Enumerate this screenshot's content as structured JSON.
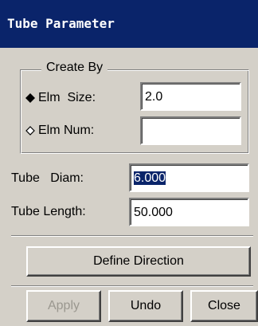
{
  "window": {
    "title": "Tube Parameter"
  },
  "create_by": {
    "legend": "Create By",
    "options": [
      {
        "label": "Elm  Size:",
        "selected": true,
        "value": "2.0"
      },
      {
        "label": "Elm Num:",
        "selected": false,
        "value": ""
      }
    ]
  },
  "tube": {
    "diam_label": "Tube   Diam:",
    "diam_value": "6.000",
    "length_label": "Tube Length:",
    "length_value": "50.000"
  },
  "buttons": {
    "define_direction": "Define Direction",
    "apply": "Apply",
    "undo": "Undo",
    "close": "Close"
  },
  "colors": {
    "titlebar": "#0a246a",
    "dialog_bg": "#d4d0c8",
    "selection": "#0a246a"
  },
  "icons": {
    "selected_radio": "filled-diamond",
    "unselected_radio": "hollow-diamond"
  }
}
